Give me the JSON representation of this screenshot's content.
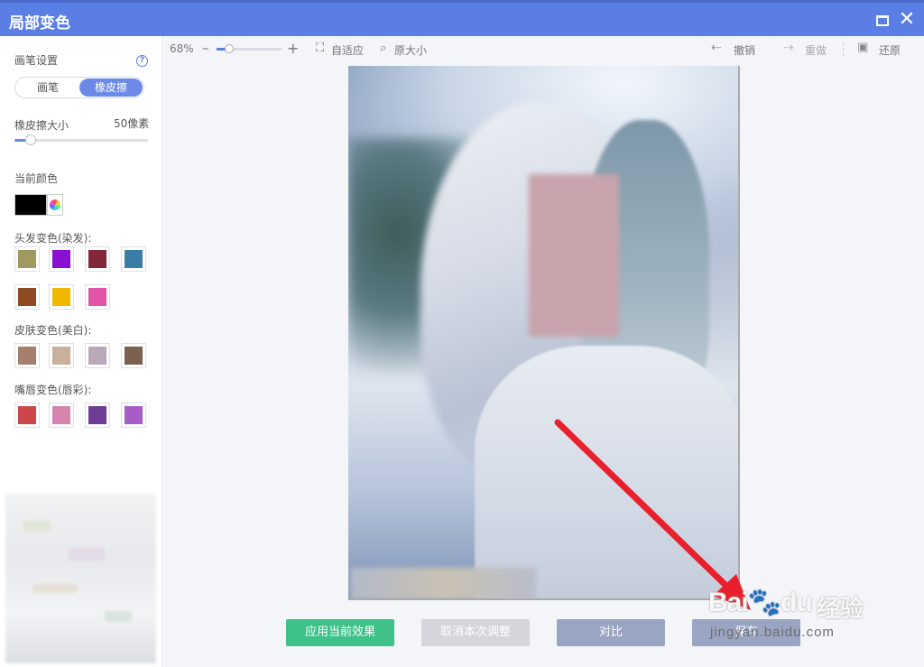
{
  "window": {
    "title": "局部变色"
  },
  "sidebar": {
    "brush_settings_label": "画笔设置",
    "tabs": [
      "画笔",
      "橡皮擦"
    ],
    "eraser_size_label": "橡皮擦大小",
    "eraser_size_value": "50像素",
    "eraser_size_level": 0.12,
    "current_color_label": "当前颜色",
    "current_color": "#000000",
    "hair_label": "头发变色(染发):",
    "hair_colors": [
      "#a19a60",
      "#8a0fd0",
      "#82283a",
      "#3a7ea8",
      "#8e4a22",
      "#f1b800",
      "#e055a8"
    ],
    "skin_label": "皮肤变色(美白):",
    "skin_colors": [
      "#a57e6c",
      "#c9b09c",
      "#b8a8b8",
      "#7a6150"
    ],
    "lip_label": "嘴唇变色(唇彩):",
    "lip_colors": [
      "#cc4848",
      "#d684ad",
      "#6e3e94",
      "#a85cc8"
    ]
  },
  "toolbar": {
    "zoom": "68%",
    "zoom_minus": "–",
    "zoom_plus": "+",
    "zoom_level": 0.2,
    "fit_label": "自适应",
    "original_label": "原大小",
    "undo_label": "撤销",
    "redo_label": "重做",
    "restore_label": "还原"
  },
  "buttons": {
    "apply": "应用当前效果",
    "cancel": "取消本次调整",
    "compare": "对比",
    "save": "保存"
  },
  "watermark": {
    "brand": "Bai",
    "brand2": "du",
    "cn": "经验",
    "url": "jingyan.baidu.com"
  },
  "colors": {
    "accent": "#5b7ee5",
    "apply": "#3fc18a",
    "arrow": "#e8202c"
  }
}
